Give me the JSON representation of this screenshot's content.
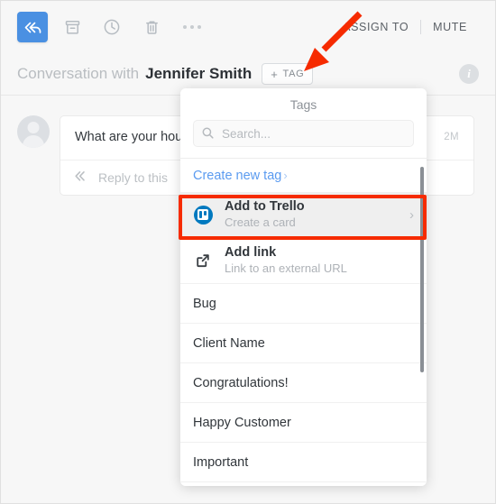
{
  "toolbar": {
    "buttons": [
      {
        "name": "reply-all-button",
        "icon": "reply-all-icon",
        "label": "Reply all",
        "active": true
      },
      {
        "name": "archive-button",
        "icon": "archive-icon",
        "label": "Archive",
        "active": false
      },
      {
        "name": "snooze-button",
        "icon": "clock-icon",
        "label": "Snooze",
        "active": false
      },
      {
        "name": "delete-button",
        "icon": "trash-icon",
        "label": "Delete",
        "active": false
      },
      {
        "name": "more-button",
        "icon": "ellipsis-icon",
        "label": "More",
        "active": false
      }
    ],
    "assign_to_label": "ASSIGN TO",
    "mute_label": "MUTE"
  },
  "conversation": {
    "prefix": "Conversation with",
    "contact_name": "Jennifer Smith",
    "tag_button": {
      "plus": "+",
      "label": "TAG"
    },
    "info_icon_label": "i",
    "message": {
      "text": "What are your hou appointment?",
      "time": "2M",
      "reply_label": "Reply to this"
    }
  },
  "tags_panel": {
    "title": "Tags",
    "search_placeholder": "Search...",
    "search_value": "",
    "create_new_tag": "Create new tag",
    "create_new_tag_chevron": "›",
    "actions": [
      {
        "title": "Add to Trello",
        "subtitle": "Create a card",
        "icon": "trello-icon",
        "arrow": "›",
        "selected": true
      },
      {
        "title": "Add link",
        "subtitle": "Link to an external URL",
        "icon": "external-link-icon",
        "arrow": "",
        "selected": false
      }
    ],
    "tags": [
      {
        "label": "Bug"
      },
      {
        "label": "Client Name"
      },
      {
        "label": "Congratulations!"
      },
      {
        "label": "Happy Customer"
      },
      {
        "label": "Important"
      }
    ]
  },
  "annotations": {
    "arrow_color": "#f62b00",
    "highlight_color": "#f62b00",
    "arrow_target": "tag-button",
    "highlight_target": "add-to-trello-row"
  },
  "colors": {
    "accent_blue": "#4a90e2",
    "link_blue": "#5b9bf0",
    "trello_blue": "#0079bf",
    "page_bg": "#f7f7f7",
    "panel_bg": "#ffffff",
    "selected_row_bg": "#efefef"
  }
}
